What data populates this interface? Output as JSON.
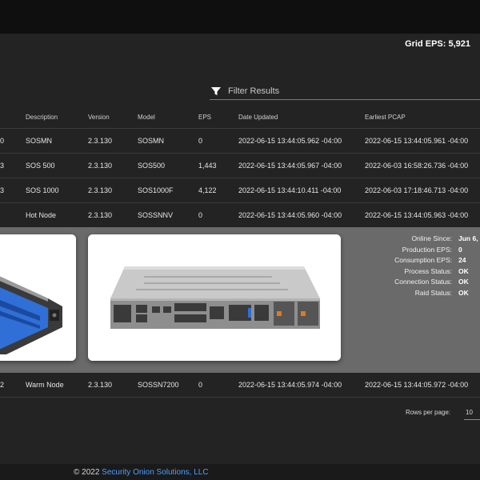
{
  "header": {
    "grid_eps": "Grid EPS: 5,921"
  },
  "filter": {
    "label": "Filter Results"
  },
  "table": {
    "columns": [
      "Description",
      "Version",
      "Model",
      "EPS",
      "Date Updated",
      "Earliest PCAP"
    ],
    "rows": [
      {
        "id": "0",
        "description": "SOSMN",
        "version": "2.3.130",
        "model": "SOSMN",
        "eps": "0",
        "date_updated": "2022-06-15 13:44:05.962 -04:00",
        "earliest_pcap": "2022-06-15 13:44:05.961 -04:00"
      },
      {
        "id": "3",
        "description": "SOS 500",
        "version": "2.3.130",
        "model": "SOS500",
        "eps": "1,443",
        "date_updated": "2022-06-15 13:44:05.967 -04:00",
        "earliest_pcap": "2022-06-03 16:58:26.736 -04:00"
      },
      {
        "id": "3",
        "description": "SOS 1000",
        "version": "2.3.130",
        "model": "SOS1000F",
        "eps": "4,122",
        "date_updated": "2022-06-15 13:44:10.411 -04:00",
        "earliest_pcap": "2022-06-03 17:18:46.713 -04:00"
      },
      {
        "id": "",
        "description": "Hot Node",
        "version": "2.3.130",
        "model": "SOSSNNV",
        "eps": "0",
        "date_updated": "2022-06-15 13:44:05.960 -04:00",
        "earliest_pcap": "2022-06-15 13:44:05.963 -04:00"
      }
    ],
    "after_rows": [
      {
        "id": "2",
        "description": "Warm Node",
        "version": "2.3.130",
        "model": "SOSSN7200",
        "eps": "0",
        "date_updated": "2022-06-15 13:44:05.974 -04:00",
        "earliest_pcap": "2022-06-15 13:44:05.972 -04:00"
      }
    ]
  },
  "details": {
    "stats": [
      {
        "label": "Online Since:",
        "value": "Jun 6,"
      },
      {
        "label": "Production EPS:",
        "value": "0"
      },
      {
        "label": "Consumption EPS:",
        "value": "24"
      },
      {
        "label": "Process Status:",
        "value": "OK"
      },
      {
        "label": "Connection Status:",
        "value": "OK"
      },
      {
        "label": "Raid Status:",
        "value": "OK"
      }
    ]
  },
  "pagination": {
    "rows_per_page_label": "Rows per page:",
    "rows_per_page_value": "10"
  },
  "footer": {
    "copyright": "© 2022 ",
    "company": "Security Onion Solutions, LLC"
  },
  "colors": {
    "accent_link": "#4a9fff",
    "server_blue": "#2f6fd6"
  }
}
